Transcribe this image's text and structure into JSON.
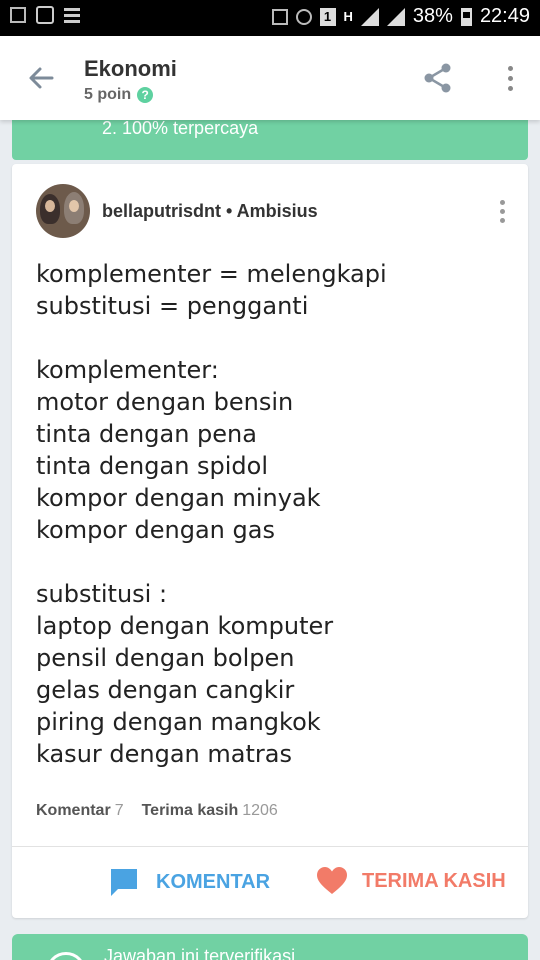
{
  "status_bar": {
    "battery": "38%",
    "time": "22:49",
    "sim_badge": "1",
    "network": "H"
  },
  "header": {
    "title": "Ekonomi",
    "points": "5 poin",
    "help_symbol": "?"
  },
  "previous_banner": {
    "text": "2. 100% terpercaya"
  },
  "answer": {
    "author": "bellaputrisdnt • Ambisius",
    "lines": [
      "komplementer = melengkapi",
      "substitusi = pengganti",
      "",
      "komplementer:",
      "motor dengan bensin",
      "tinta dengan pena",
      "tinta dengan spidol",
      "kompor dengan minyak",
      "kompor dengan gas",
      "",
      "substitusi :",
      "laptop dengan komputer",
      "pensil dengan bolpen",
      "gelas dengan cangkir",
      "piring dengan mangkok",
      "kasur dengan matras"
    ],
    "comments_label": "Komentar",
    "comments_count": "7",
    "thanks_label": "Terima kasih",
    "thanks_count": "1206",
    "comment_button": "KOMENTAR",
    "thanks_button": "TERIMA KASIH"
  },
  "next_banner": {
    "text": "Jawaban ini terverifikasi"
  },
  "colors": {
    "accent_green": "#71d1a3",
    "comment_blue": "#4aa3e2",
    "thanks_red": "#f27b68"
  }
}
